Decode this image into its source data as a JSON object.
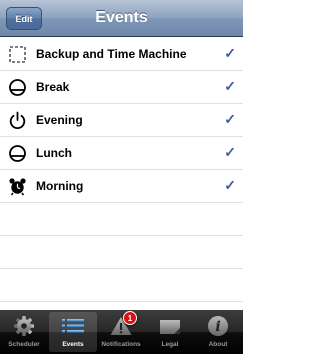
{
  "navbar": {
    "title": "Events",
    "edit_label": "Edit"
  },
  "events": [
    {
      "label": "Backup and Time Machine",
      "icon": "dashed-square-icon",
      "checked": true
    },
    {
      "label": "Break",
      "icon": "sleep-icon",
      "checked": true
    },
    {
      "label": "Evening",
      "icon": "power-icon",
      "checked": true
    },
    {
      "label": "Lunch",
      "icon": "sleep-icon",
      "checked": true
    },
    {
      "label": "Morning",
      "icon": "alarm-clock-icon",
      "checked": true
    }
  ],
  "check_glyph": "✓",
  "tabs": [
    {
      "label": "Scheduler",
      "icon": "gear-icon",
      "selected": false
    },
    {
      "label": "Events",
      "icon": "list-icon",
      "selected": true
    },
    {
      "label": "Notifications",
      "icon": "warning-icon",
      "selected": false,
      "badge": "1"
    },
    {
      "label": "Legal",
      "icon": "document-icon",
      "selected": false
    },
    {
      "label": "About",
      "icon": "info-icon",
      "selected": false
    }
  ],
  "colors": {
    "navbar": "#8fa4c0",
    "check": "#3a5d9a",
    "tabbar": "#1a1a1a",
    "badge": "#dd1111"
  }
}
